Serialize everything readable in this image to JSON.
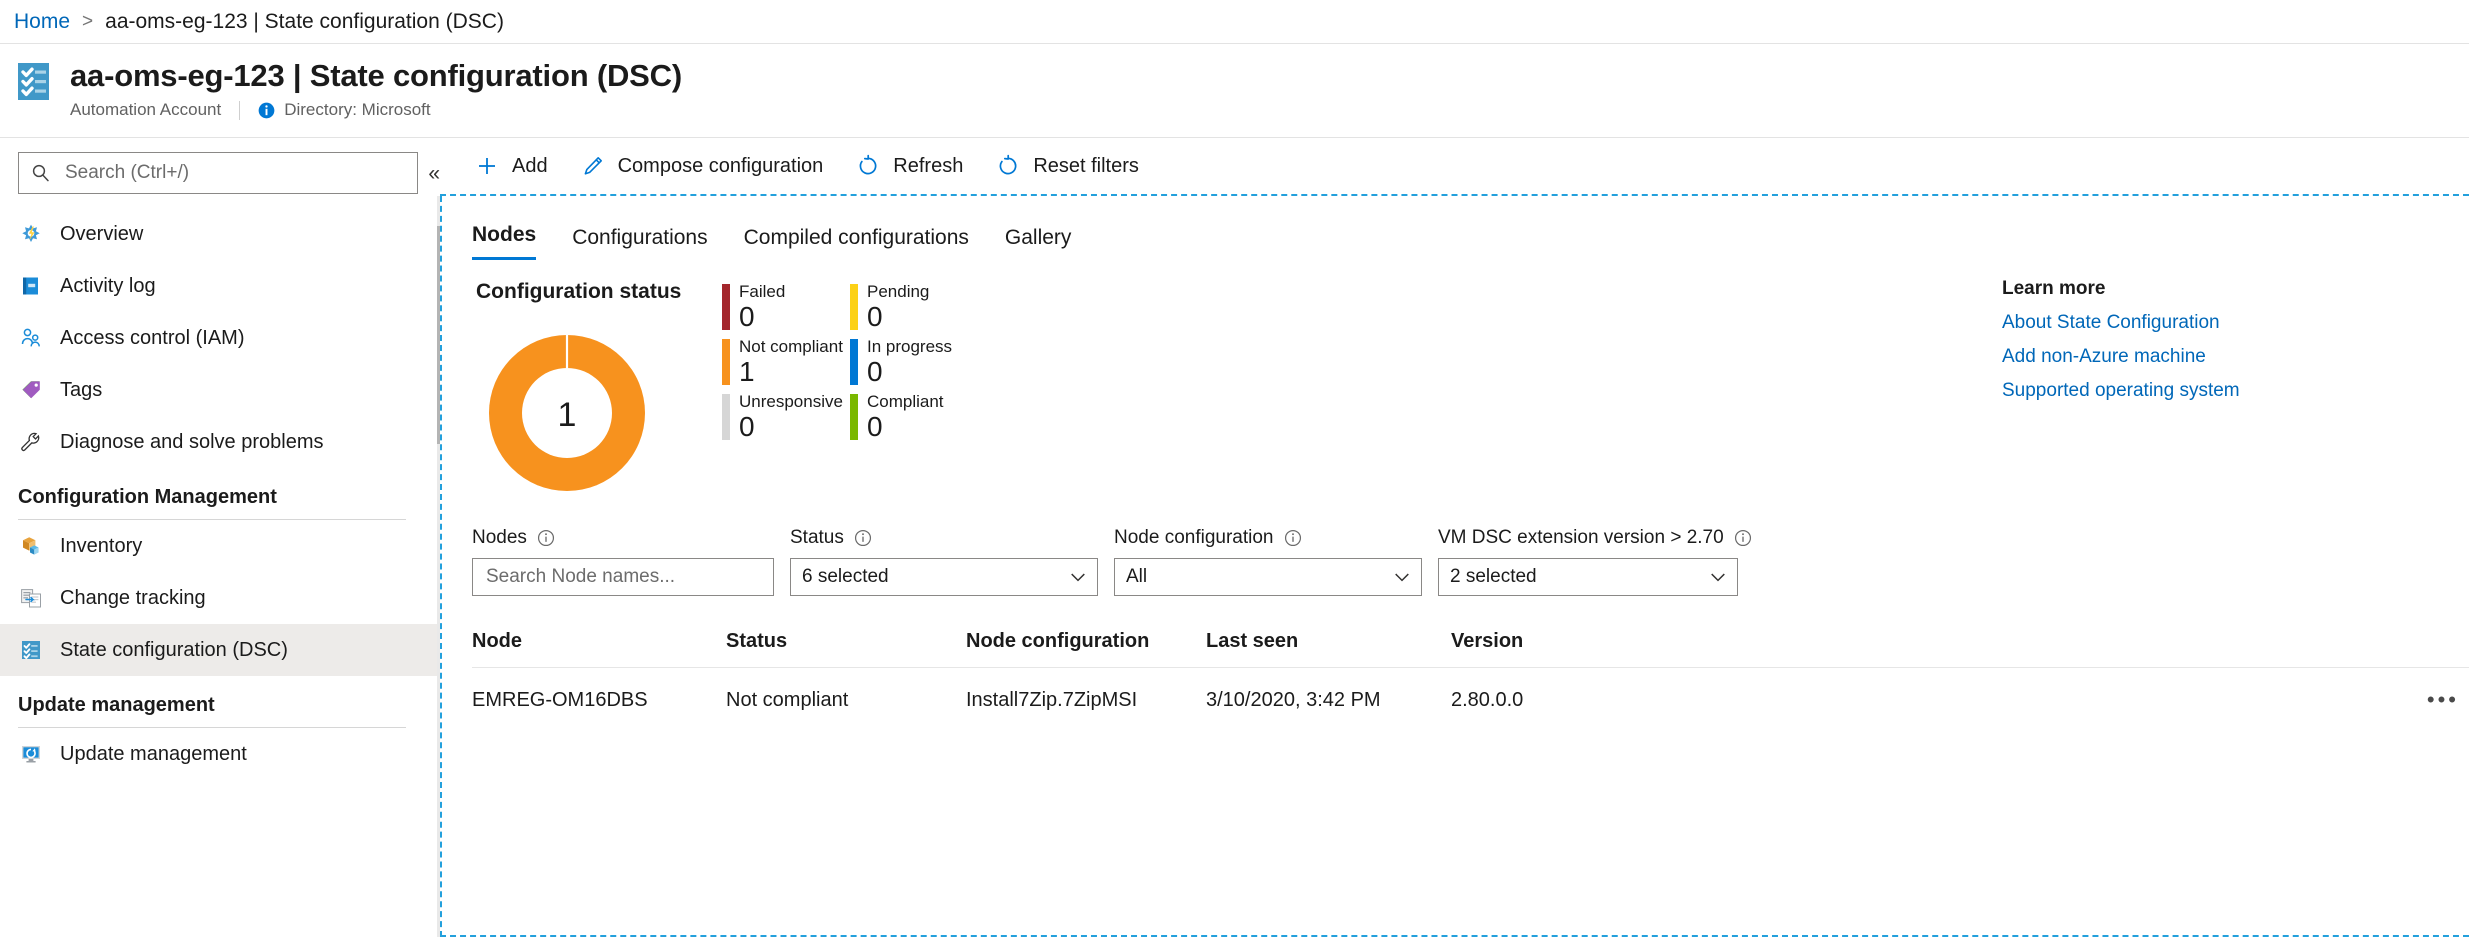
{
  "breadcrumb": {
    "home": "Home",
    "separator": ">",
    "current": "aa-oms-eg-123 | State configuration (DSC)"
  },
  "header": {
    "icon": "dsc-checklist-icon",
    "title": "aa-oms-eg-123 | State configuration (DSC)",
    "resource_type": "Automation Account",
    "info_icon": "info-icon",
    "directory": "Directory: Microsoft"
  },
  "sidebar": {
    "search": {
      "placeholder": "Search (Ctrl+/)",
      "value": "",
      "icon": "search-icon"
    },
    "collapse_label": "«",
    "items": [
      {
        "label": "Overview",
        "icon": "overview-icon",
        "selected": false
      },
      {
        "label": "Activity log",
        "icon": "activity-log-icon",
        "selected": false
      },
      {
        "label": "Access control (IAM)",
        "icon": "access-control-icon",
        "selected": false
      },
      {
        "label": "Tags",
        "icon": "tags-icon",
        "selected": false
      },
      {
        "label": "Diagnose and solve problems",
        "icon": "wrench-icon",
        "selected": false
      }
    ],
    "groups": [
      {
        "title": "Configuration Management",
        "items": [
          {
            "label": "Inventory",
            "icon": "inventory-icon",
            "selected": false
          },
          {
            "label": "Change tracking",
            "icon": "change-tracking-icon",
            "selected": false
          },
          {
            "label": "State configuration (DSC)",
            "icon": "dsc-checklist-icon",
            "selected": true
          }
        ]
      },
      {
        "title": "Update management",
        "items": [
          {
            "label": "Update management",
            "icon": "update-management-icon",
            "selected": false
          }
        ]
      }
    ]
  },
  "toolbar": {
    "buttons": [
      {
        "label": "Add",
        "icon": "plus-icon"
      },
      {
        "label": "Compose configuration",
        "icon": "pencil-icon"
      },
      {
        "label": "Refresh",
        "icon": "refresh-icon"
      },
      {
        "label": "Reset filters",
        "icon": "reset-icon"
      }
    ]
  },
  "tabs": [
    {
      "label": "Nodes",
      "active": true
    },
    {
      "label": "Configurations",
      "active": false
    },
    {
      "label": "Compiled configurations",
      "active": false
    },
    {
      "label": "Gallery",
      "active": false
    }
  ],
  "chart_data": {
    "type": "pie",
    "title": "Configuration status",
    "center_value": "1",
    "categories": [
      "Failed",
      "Not compliant",
      "Unresponsive",
      "Pending",
      "In progress",
      "Compliant"
    ],
    "values": [
      0,
      1,
      0,
      0,
      0,
      0
    ],
    "colors": [
      "#a4262c",
      "#f7921e",
      "#d6d6d6",
      "#fcd116",
      "#0078d4",
      "#7ab800"
    ],
    "legend": "right-grid",
    "total": 1
  },
  "status_panel": {
    "title": "Configuration status",
    "donut_center": "1",
    "stats": [
      {
        "label": "Failed",
        "value": "0",
        "color": "#a4262c"
      },
      {
        "label": "Pending",
        "value": "0",
        "color": "#fcd116"
      },
      {
        "label": "Not compliant",
        "value": "1",
        "color": "#f7921e"
      },
      {
        "label": "In progress",
        "value": "0",
        "color": "#0078d4"
      },
      {
        "label": "Unresponsive",
        "value": "0",
        "color": "#d6d6d6"
      },
      {
        "label": "Compliant",
        "value": "0",
        "color": "#7ab800"
      }
    ]
  },
  "learn_more": {
    "title": "Learn more",
    "links": [
      "About State Configuration",
      "Add non-Azure machine",
      "Supported operating system"
    ]
  },
  "filters": [
    {
      "label": "Nodes",
      "info_icon": "info-circle-icon",
      "type": "search",
      "placeholder": "Search Node names...",
      "value": ""
    },
    {
      "label": "Status",
      "info_icon": "info-circle-icon",
      "type": "dropdown",
      "value": "6 selected"
    },
    {
      "label": "Node configuration",
      "info_icon": "info-circle-icon",
      "type": "dropdown",
      "value": "All"
    },
    {
      "label": "VM DSC extension version > 2.70",
      "info_icon": "info-circle-icon",
      "type": "dropdown",
      "value": "2 selected"
    }
  ],
  "table": {
    "columns": [
      "Node",
      "Status",
      "Node configuration",
      "Last seen",
      "Version"
    ],
    "rows": [
      {
        "node": "EMREG-OM16DBS",
        "status": "Not compliant",
        "node_configuration": "Install7Zip.7ZipMSI",
        "last_seen": "3/10/2020, 3:42 PM",
        "version": "2.80.0.0",
        "menu": "•••"
      }
    ]
  },
  "colors": {
    "accent": "#0078d4",
    "link": "#0067b8",
    "dashed_border": "#23a0dc",
    "not_compliant": "#f7921e"
  }
}
